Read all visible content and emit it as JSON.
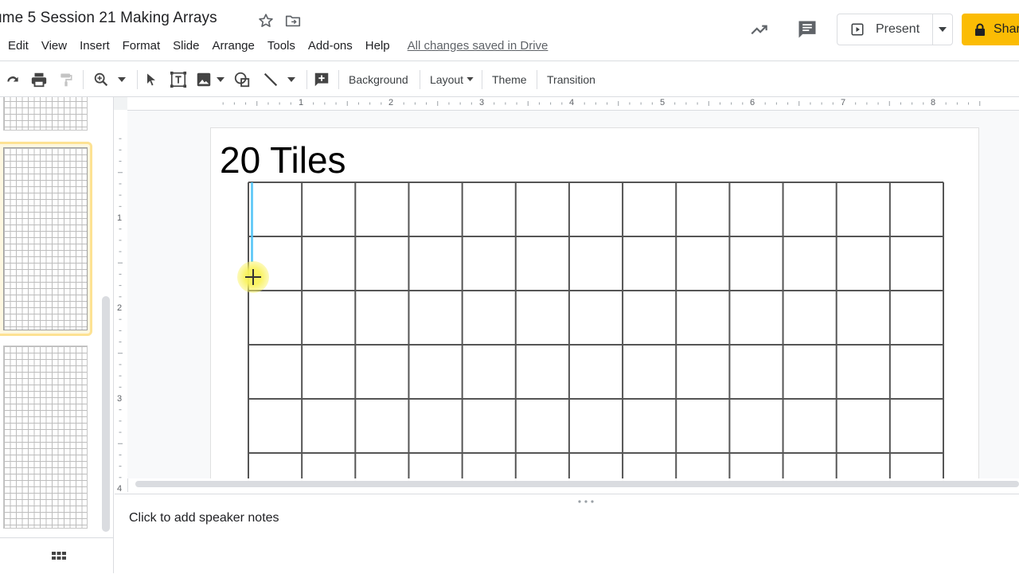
{
  "document": {
    "title": "ume 5 Session 21 Making Arrays"
  },
  "menu": {
    "items": [
      "Edit",
      "View",
      "Insert",
      "Format",
      "Slide",
      "Arrange",
      "Tools",
      "Add-ons",
      "Help"
    ],
    "save_status": "All changes saved in Drive"
  },
  "actions": {
    "present_label": "Present",
    "share_label": "Shar"
  },
  "toolbar": {
    "background_label": "Background",
    "layout_label": "Layout",
    "theme_label": "Theme",
    "transition_label": "Transition"
  },
  "ruler": {
    "horizontal": [
      "1",
      "2",
      "3",
      "4",
      "5",
      "6",
      "7",
      "8"
    ],
    "vertical": [
      "1",
      "2",
      "3",
      "4"
    ]
  },
  "slide": {
    "title": "20 Tiles",
    "grid": {
      "columns": 13,
      "rows_visible": 6
    }
  },
  "notes": {
    "placeholder": "Click to add speaker notes"
  },
  "colors": {
    "accent_share": "#fbbc04",
    "selected_thumb_border": "#fde293",
    "cursor_highlight": "#f9f25c"
  }
}
